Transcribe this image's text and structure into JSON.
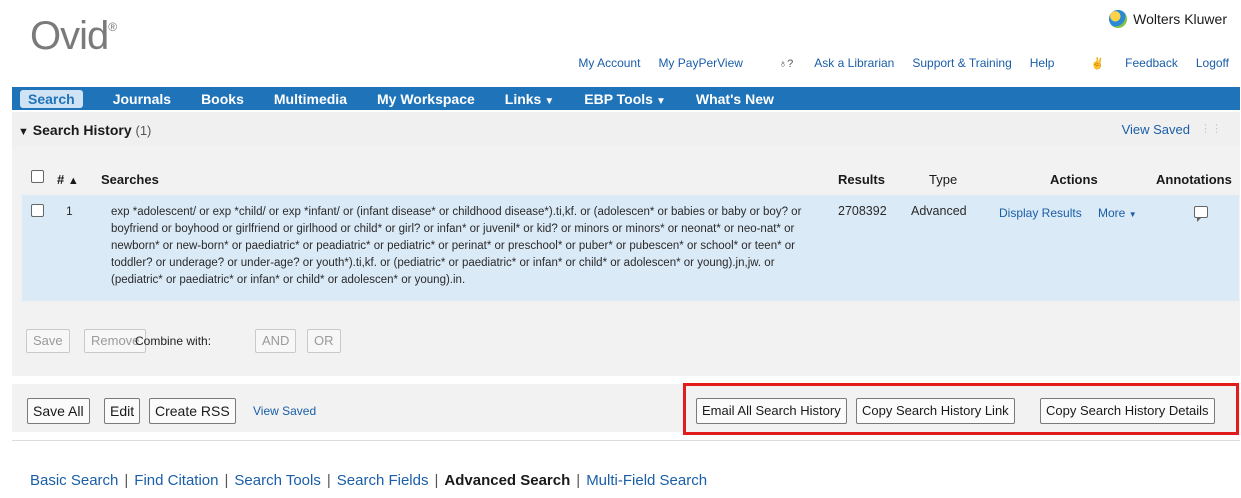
{
  "header": {
    "logo": "Ovid",
    "logo_mark": "®",
    "brand": "Wolters Kluwer",
    "links": [
      "My Account",
      "My PayPerView",
      "Ask a Librarian",
      "Support & Training",
      "Help",
      "Feedback",
      "Logoff"
    ]
  },
  "nav": {
    "items": [
      "Search",
      "Journals",
      "Books",
      "Multimedia",
      "My Workspace",
      "Links",
      "EBP Tools",
      "What's New"
    ]
  },
  "history": {
    "title": "Search History",
    "count": "(1)",
    "view_saved": "View Saved",
    "columns": {
      "num": "#",
      "sort": "▲",
      "searches": "Searches",
      "results": "Results",
      "type": "Type",
      "actions": "Actions",
      "annotations": "Annotations"
    },
    "rows": [
      {
        "num": "1",
        "query": "exp *adolescent/ or exp *child/ or exp *infant/ or (infant disease* or childhood disease*).ti,kf. or (adolescen* or babies or baby or boy? or boyfriend or boyhood or girlfriend or girlhood or child* or girl? or infan* or juvenil* or kid? or minors or minors* or neonat* or neo-nat* or newborn* or new-born* or paediatric* or peadiatric* or pediatric* or perinat* or preschool* or puber* or pubescen* or school* or teen* or toddler? or underage? or under-age? or youth*).ti,kf. or (pediatric* or paediatric* or infan* or child* or adolescen* or young).jn,jw. or (pediatric* or paediatric* or infan* or child* or adolescen* or young).in.",
        "results": "2708392",
        "type": "Advanced",
        "display_results": "Display Results",
        "more": "More"
      }
    ],
    "row_buttons": {
      "save": "Save",
      "remove": "Remove",
      "combine_with": "Combine with:",
      "and": "AND",
      "or": "OR"
    }
  },
  "footer_buttons": {
    "save_all": "Save All",
    "edit": "Edit",
    "create_rss": "Create RSS",
    "view_saved": "View Saved",
    "email_all": "Email All Search History",
    "copy_link": "Copy Search History Link",
    "copy_details": "Copy Search History Details"
  },
  "search_modes": {
    "items": [
      "Basic Search",
      "Find Citation",
      "Search Tools",
      "Search Fields",
      "Advanced Search",
      "Multi-Field Search"
    ],
    "current": "Advanced Search"
  },
  "colors": {
    "nav_bg": "#1f74b9",
    "highlight_box": "#e21c1c",
    "row_bg": "#dbeaf7",
    "link": "#1a5ea8"
  }
}
